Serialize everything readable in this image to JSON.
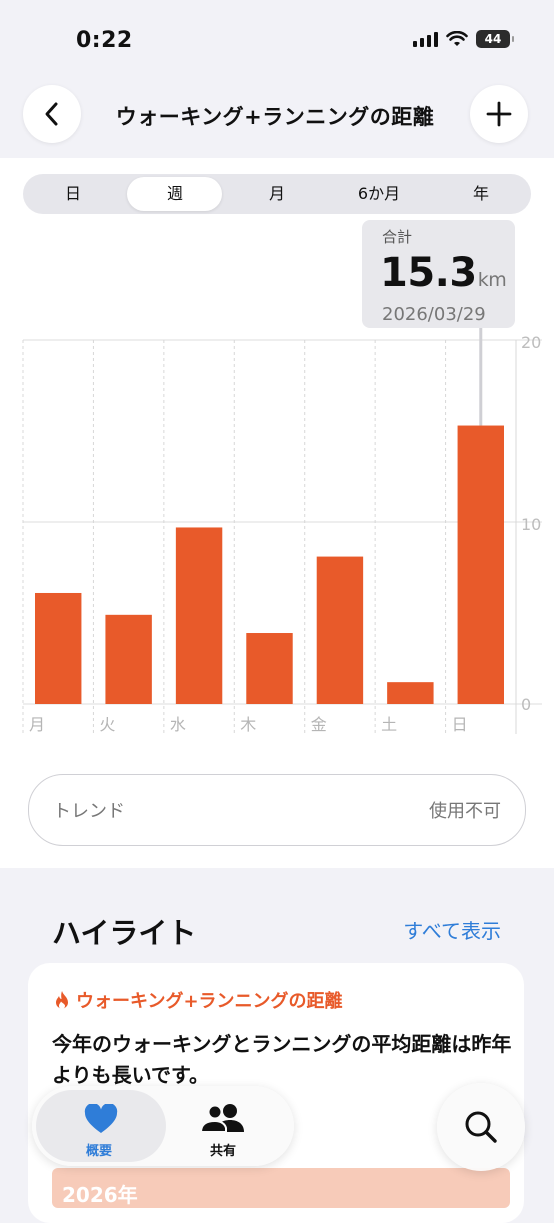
{
  "status_bar": {
    "time": "0:22",
    "battery": "44"
  },
  "nav": {
    "title": "ウォーキング+ランニングの距離"
  },
  "segments": [
    "日",
    "週",
    "月",
    "6か月",
    "年"
  ],
  "selected_segment": "週",
  "callout": {
    "label": "合計",
    "value": "15.3",
    "unit": "km",
    "date": "2026/03/29"
  },
  "chart_data": {
    "type": "bar",
    "categories": [
      "月",
      "火",
      "水",
      "木",
      "金",
      "土",
      "日"
    ],
    "values": [
      6.1,
      4.9,
      9.7,
      3.9,
      8.1,
      1.2,
      15.3
    ],
    "ylim": [
      0,
      20
    ],
    "yticks": [
      "0",
      "10",
      "20"
    ],
    "bar_color": "#e85a2a",
    "highlighted_category": "日",
    "grid": true
  },
  "trend": {
    "label": "トレンド",
    "value": "使用不可"
  },
  "highlights": {
    "title": "ハイライト",
    "see_all": "すべて表示",
    "card": {
      "category": "ウォーキング+ランニングの距離",
      "text": "今年のウォーキングとランニングの平均距離は昨年よりも長いです。",
      "bar_label": "2026年"
    }
  },
  "tabs": [
    {
      "label": "概要",
      "active": true
    },
    {
      "label": "共有",
      "active": false
    }
  ],
  "colors": {
    "accent": "#e85a2a",
    "link": "#2f7dd8",
    "tab_active": "#2f7dd8"
  }
}
